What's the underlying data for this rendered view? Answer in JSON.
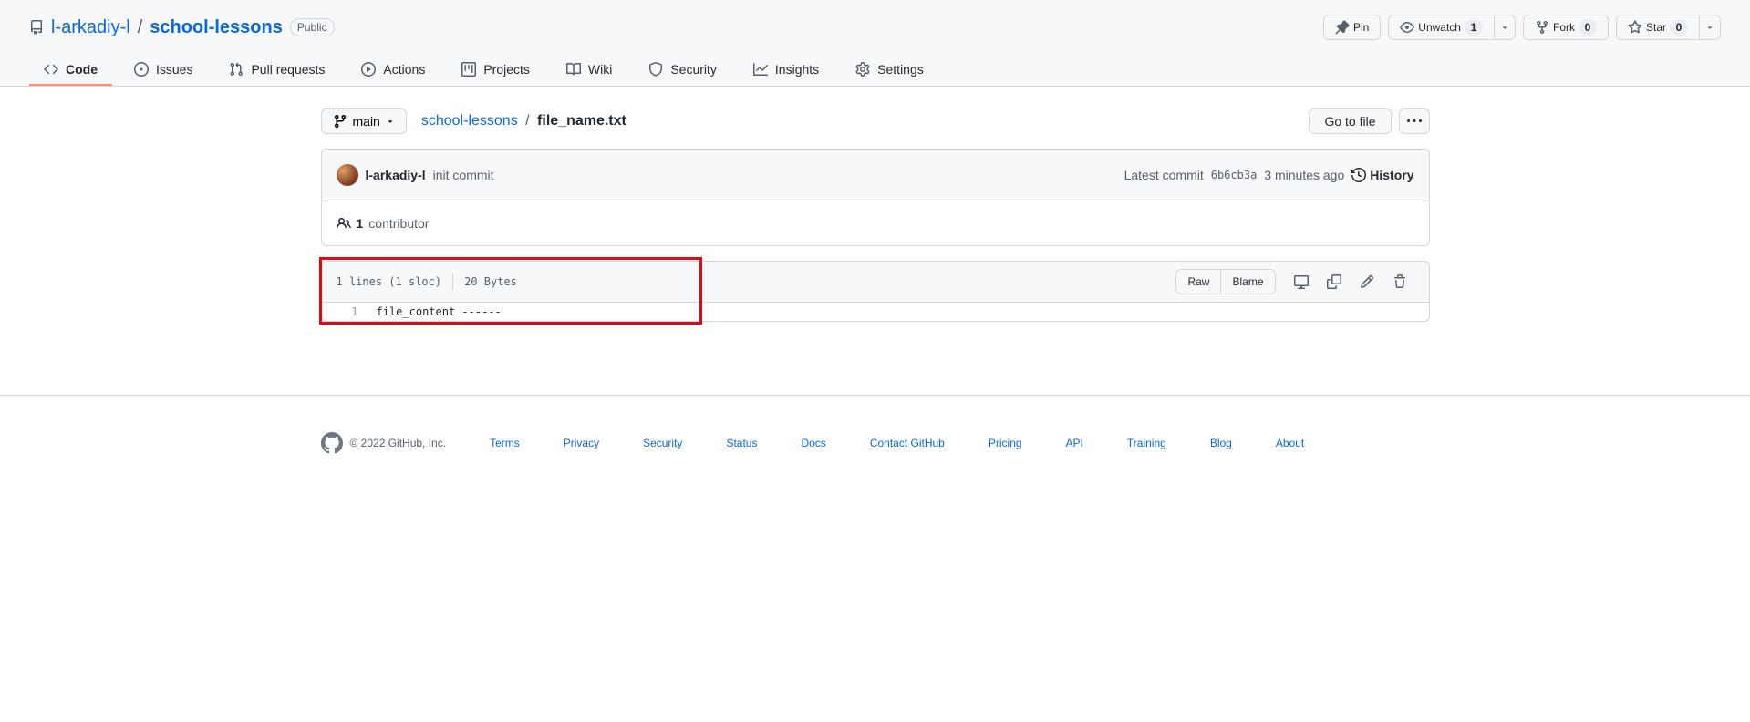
{
  "repo": {
    "owner": "l-arkadiy-l",
    "name": "school-lessons",
    "visibility": "Public"
  },
  "actions": {
    "pin": "Pin",
    "unwatch": "Unwatch",
    "unwatch_count": "1",
    "fork": "Fork",
    "fork_count": "0",
    "star": "Star",
    "star_count": "0"
  },
  "nav": {
    "code": "Code",
    "issues": "Issues",
    "pulls": "Pull requests",
    "actions": "Actions",
    "projects": "Projects",
    "wiki": "Wiki",
    "security": "Security",
    "insights": "Insights",
    "settings": "Settings"
  },
  "branch": {
    "label": "main"
  },
  "breadcrumb": {
    "root": "school-lessons",
    "file": "file_name.txt"
  },
  "goto": "Go to file",
  "commit": {
    "author": "l-arkadiy-l",
    "message": "init commit",
    "latest_label": "Latest commit",
    "sha": "6b6cb3a",
    "time": "3 minutes ago",
    "history": "History"
  },
  "contributors": {
    "count": "1",
    "label": "contributor"
  },
  "file_meta": {
    "lines": "1 lines (1 sloc)",
    "size": "20 Bytes"
  },
  "file_actions": {
    "raw": "Raw",
    "blame": "Blame"
  },
  "file_lines": [
    {
      "num": "1",
      "content": "file_content ------"
    }
  ],
  "footer": {
    "copyright": "© 2022 GitHub, Inc.",
    "links": [
      "Terms",
      "Privacy",
      "Security",
      "Status",
      "Docs",
      "Contact GitHub",
      "Pricing",
      "API",
      "Training",
      "Blog",
      "About"
    ]
  }
}
